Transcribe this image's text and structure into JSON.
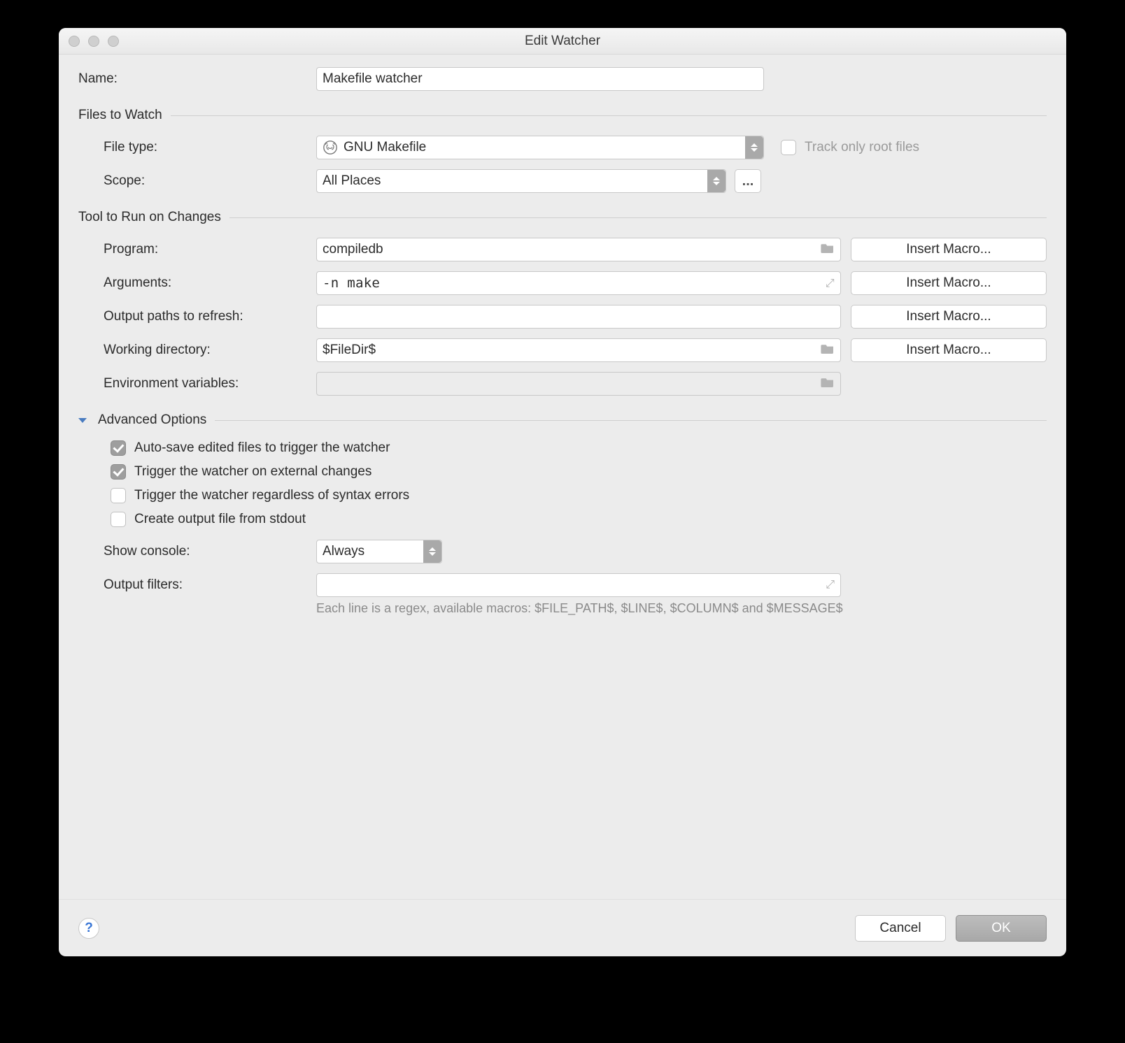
{
  "window": {
    "title": "Edit Watcher"
  },
  "name": {
    "label": "Name:",
    "value": "Makefile watcher"
  },
  "sections": {
    "files_to_watch": "Files to Watch",
    "tool_to_run": "Tool to Run on Changes",
    "advanced": "Advanced Options"
  },
  "labels": {
    "file_type": "File type:",
    "scope": "Scope:",
    "program": "Program:",
    "arguments": "Arguments:",
    "output_paths": "Output paths to refresh:",
    "working_dir": "Working directory:",
    "env_vars": "Environment variables:",
    "show_console": "Show console:",
    "output_filters": "Output filters:"
  },
  "fields": {
    "file_type": "GNU Makefile",
    "scope": "All Places",
    "scope_more": "...",
    "program": "compiledb",
    "arguments": "-n make",
    "output_paths": "",
    "working_dir": "$FileDir$",
    "env_vars": "",
    "show_console": "Always",
    "output_filters": ""
  },
  "track_only_root": "Track only root files",
  "insert_macro": "Insert Macro...",
  "checks": {
    "auto_save": "Auto-save edited files to trigger the watcher",
    "trigger_external": "Trigger the watcher on external changes",
    "trigger_syntax": "Trigger the watcher regardless of syntax errors",
    "create_output": "Create output file from stdout"
  },
  "hint": "Each line is a regex, available macros: $FILE_PATH$, $LINE$, $COLUMN$ and $MESSAGE$",
  "footer": {
    "help": "?",
    "cancel": "Cancel",
    "ok": "OK"
  }
}
